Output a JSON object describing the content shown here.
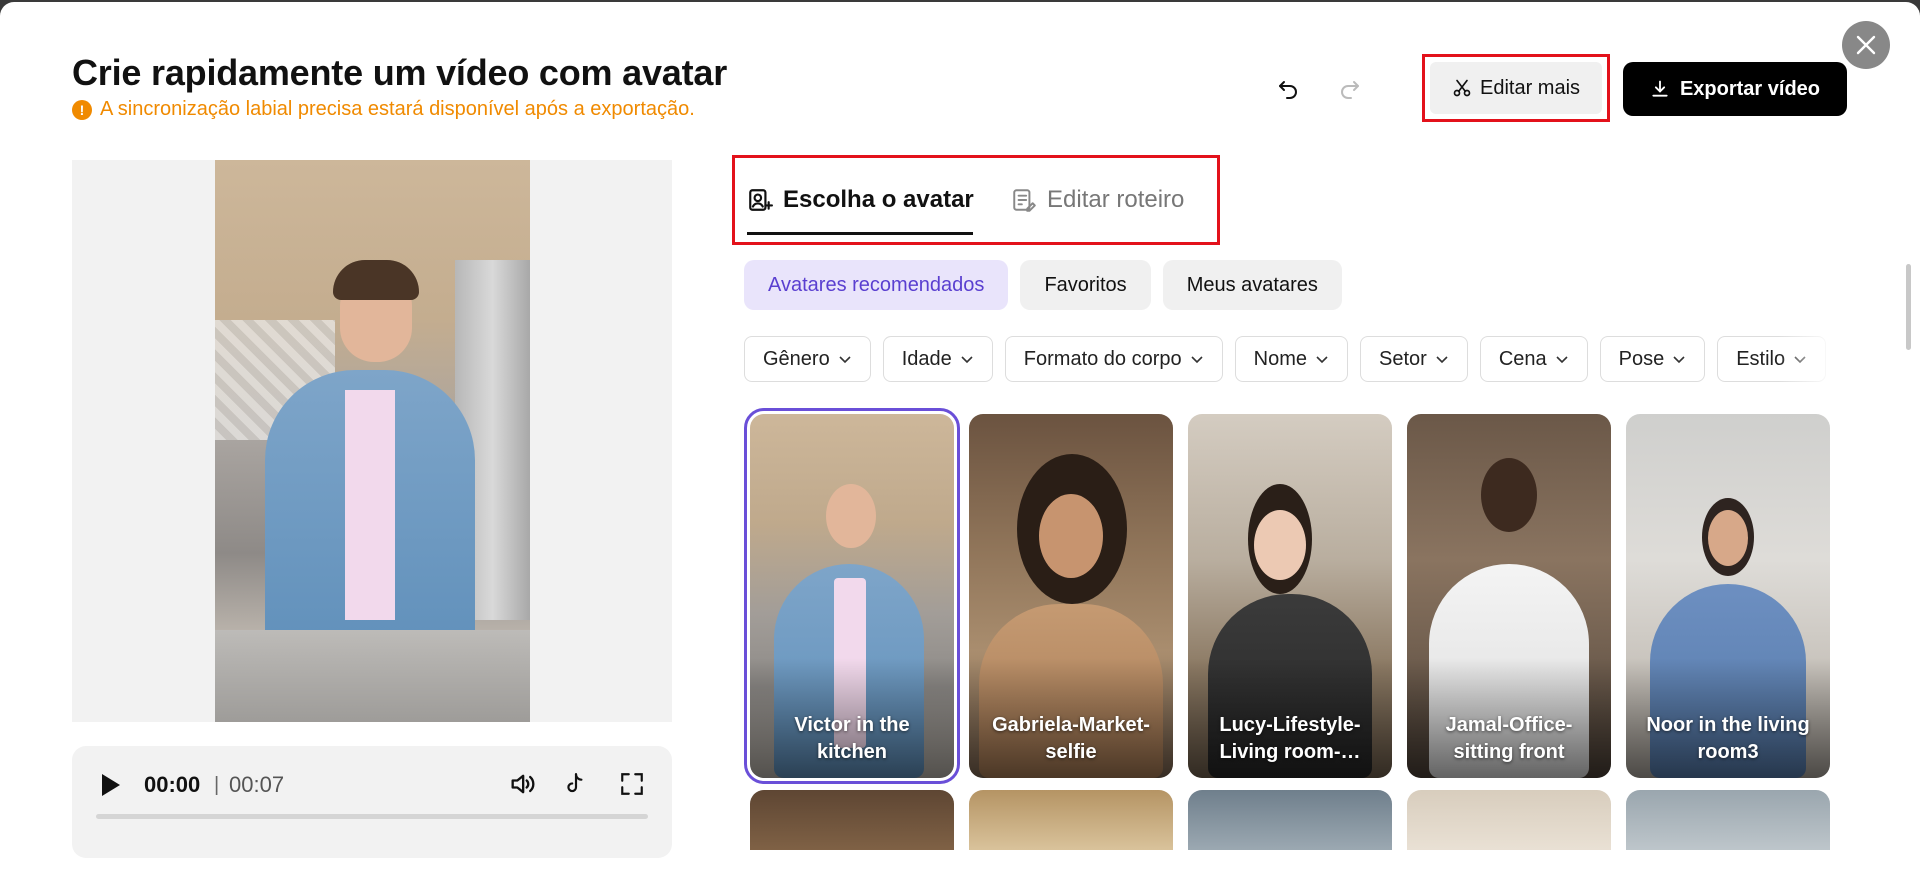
{
  "header": {
    "title": "Crie rapidamente um vídeo com avatar",
    "warning": "A sincronização labial precisa estará disponível após a exportação.",
    "warning_icon": "!"
  },
  "toolbar": {
    "undo_icon": "undo-icon",
    "redo_icon": "redo-icon",
    "edit_more_label": "Editar mais",
    "export_label": "Exportar vídeo"
  },
  "player": {
    "current_time": "00:00",
    "separator": "|",
    "total_time": "00:07",
    "progress": 0
  },
  "tabs": [
    {
      "label": "Escolha o avatar",
      "active": true
    },
    {
      "label": "Editar roteiro",
      "active": false
    }
  ],
  "chips": [
    {
      "label": "Avatares recomendados",
      "active": true
    },
    {
      "label": "Favoritos",
      "active": false
    },
    {
      "label": "Meus avatares",
      "active": false
    }
  ],
  "filters": [
    "Gênero",
    "Idade",
    "Formato do corpo",
    "Nome",
    "Setor",
    "Cena",
    "Pose",
    "Estilo"
  ],
  "avatars": [
    {
      "name": "Victor in the kitchen",
      "selected": true
    },
    {
      "name": "Gabriela-Market-selfie",
      "selected": false
    },
    {
      "name": "Lucy-Lifestyle-Living room-…",
      "selected": false
    },
    {
      "name": "Jamal-Office-sitting front",
      "selected": false
    },
    {
      "name": "Noor in the living room3",
      "selected": false
    }
  ],
  "colors": {
    "accent": "#5a3fd0",
    "warning": "#f08a00",
    "highlight_border": "#e3111b",
    "export_bg": "#000000"
  }
}
